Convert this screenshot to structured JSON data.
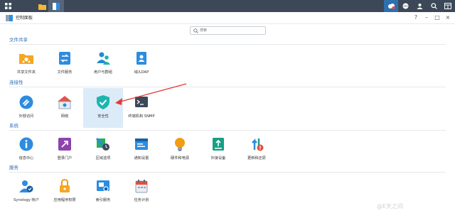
{
  "window": {
    "title": "控制面板"
  },
  "search": {
    "placeholder": "搜索"
  },
  "sections": {
    "file_sharing": {
      "title": "文件共享",
      "items": [
        {
          "label": "共享文件夹",
          "icon": "shared-folder-icon"
        },
        {
          "label": "文件服务",
          "icon": "file-services-icon"
        },
        {
          "label": "用户与群组",
          "icon": "user-group-icon"
        },
        {
          "label": "域/LDAP",
          "icon": "domain-ldap-icon"
        }
      ]
    },
    "connectivity": {
      "title": "连接性",
      "items": [
        {
          "label": "外部访问",
          "icon": "external-access-icon"
        },
        {
          "label": "网络",
          "icon": "network-icon"
        },
        {
          "label": "安全性",
          "icon": "security-shield-icon",
          "selected": true
        },
        {
          "label": "终端机和 SNMP",
          "icon": "terminal-snmp-icon"
        }
      ]
    },
    "system": {
      "title": "系统",
      "items": [
        {
          "label": "信息中心",
          "icon": "info-center-icon"
        },
        {
          "label": "登录门户",
          "icon": "login-portal-icon"
        },
        {
          "label": "区域选项",
          "icon": "regional-options-icon"
        },
        {
          "label": "通知设置",
          "icon": "notification-icon"
        },
        {
          "label": "硬件和电源",
          "icon": "hardware-power-icon"
        },
        {
          "label": "外接设备",
          "icon": "external-devices-icon"
        },
        {
          "label": "更新和还原",
          "icon": "update-restore-icon"
        }
      ]
    },
    "services": {
      "title": "服务",
      "items": [
        {
          "label": "Synology 帐户",
          "icon": "synology-account-icon"
        },
        {
          "label": "应用程序权限",
          "icon": "app-privileges-icon"
        },
        {
          "label": "索引服务",
          "icon": "indexing-service-icon"
        },
        {
          "label": "任务计划",
          "icon": "task-scheduler-icon"
        }
      ]
    }
  },
  "watermark": "@E天之间",
  "colors": {
    "accent": "#2e6fb5",
    "taskbar": "#3c4858",
    "selection": "#dcebf8",
    "annotation_arrow": "#e53935"
  }
}
